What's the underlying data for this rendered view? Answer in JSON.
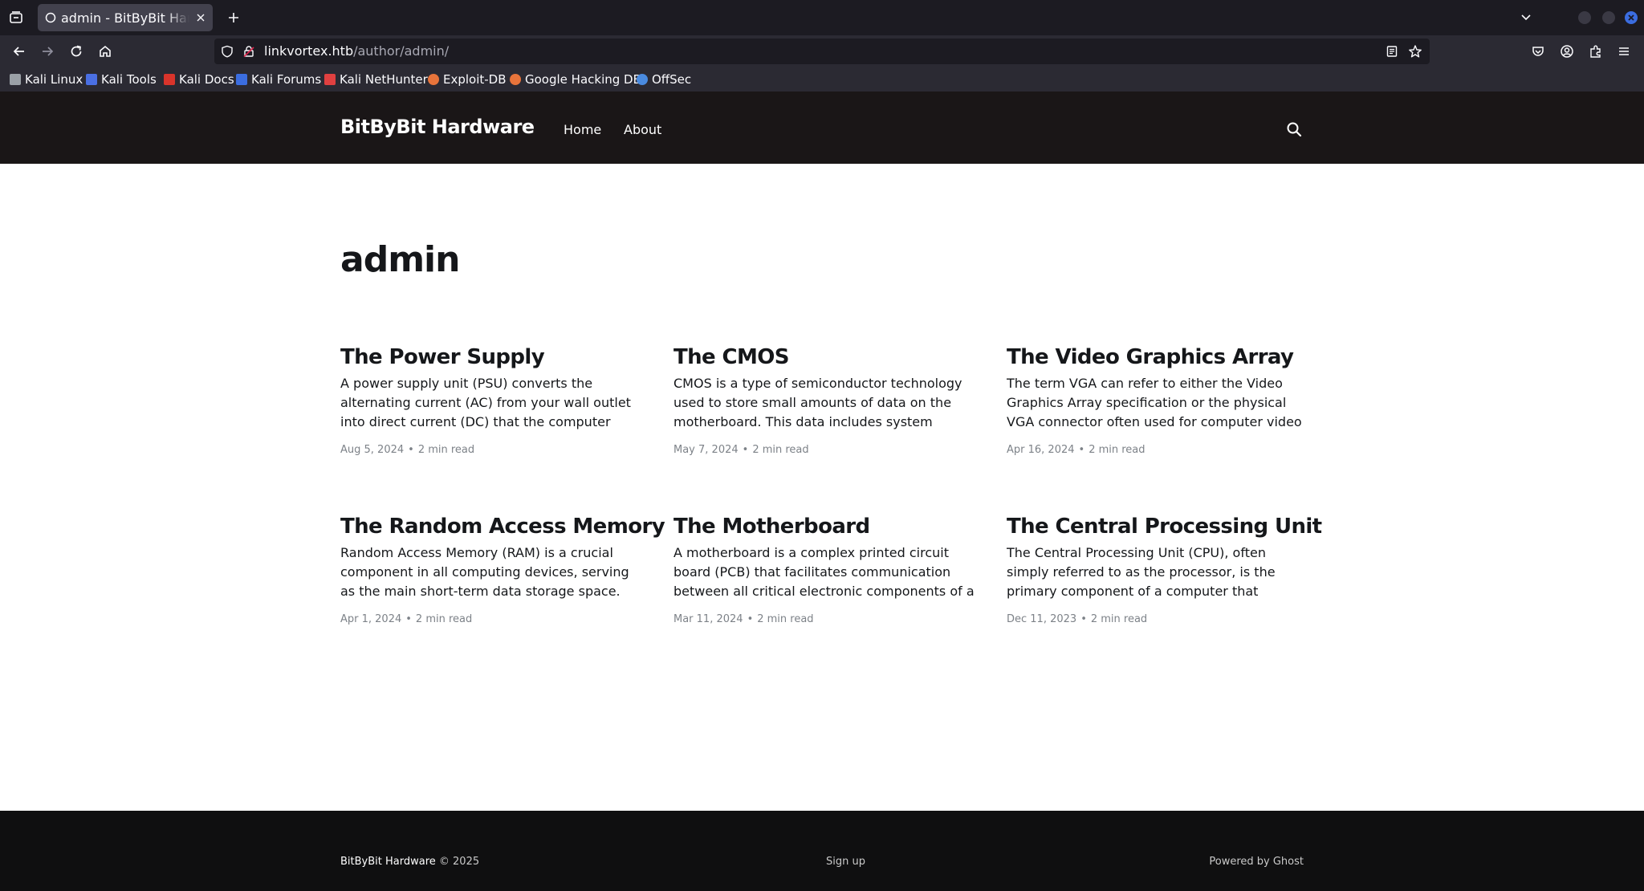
{
  "browser": {
    "tab": {
      "title": "admin - BitByBit Hardware"
    },
    "url": {
      "host": "linkvortex.htb",
      "path": "/author/admin/"
    },
    "bookmarks": [
      {
        "label": "Kali Linux",
        "icon": "kali-dragon-icon",
        "color": "#9aa0a6"
      },
      {
        "label": "Kali Tools",
        "icon": "kali-tools-icon",
        "color": "#4a6fe3"
      },
      {
        "label": "Kali Docs",
        "icon": "kali-docs-icon",
        "color": "#d9342b"
      },
      {
        "label": "Kali Forums",
        "icon": "kali-forums-icon",
        "color": "#3b6de0"
      },
      {
        "label": "Kali NetHunter",
        "icon": "nethunter-icon",
        "color": "#e04040"
      },
      {
        "label": "Exploit-DB",
        "icon": "exploitdb-icon",
        "color": "#e8743b"
      },
      {
        "label": "Google Hacking DB",
        "icon": "ghdb-icon",
        "color": "#e8743b"
      },
      {
        "label": "OffSec",
        "icon": "offsec-icon",
        "color": "#4a8be0"
      }
    ]
  },
  "site": {
    "brand": "BitByBit Hardware",
    "nav": [
      "Home",
      "About"
    ]
  },
  "author": {
    "name": "admin"
  },
  "posts": [
    {
      "title": "The Power Supply",
      "excerpt": "A power supply unit (PSU) converts the alternating current (AC) from your wall outlet into direct current (DC) that the computer components require. It…",
      "date": "Aug 5, 2024",
      "read": "2 min read"
    },
    {
      "title": "The CMOS",
      "excerpt": "CMOS is a type of semiconductor technology used to store small amounts of data on the motherboard. This data includes system settings and…",
      "date": "May 7, 2024",
      "read": "2 min read"
    },
    {
      "title": "The Video Graphics Array",
      "excerpt": "The term VGA can refer to either the Video Graphics Array specification or the physical VGA connector often used for computer video output. Below, I'll…",
      "date": "Apr 16, 2024",
      "read": "2 min read"
    },
    {
      "title": "The Random Access Memory",
      "excerpt": "Random Access Memory (RAM) is a crucial component in all computing devices, serving as the main short-term data storage space. RAM stores t…",
      "date": "Apr 1, 2024",
      "read": "2 min read"
    },
    {
      "title": "The Motherboard",
      "excerpt": "A motherboard is a complex printed circuit board (PCB) that facilitates communication between all critical electronic components of a computer,…",
      "date": "Mar 11, 2024",
      "read": "2 min read"
    },
    {
      "title": "The Central Processing Unit",
      "excerpt": "The Central Processing Unit (CPU), often simply referred to as the processor, is the primary component of a computer that performs most of…",
      "date": "Dec 11, 2023",
      "read": "2 min read"
    }
  ],
  "meta_separator": "•",
  "footer": {
    "brand": "BitByBit Hardware",
    "copyright": "© 2025",
    "signup": "Sign up",
    "powered": "Powered by Ghost"
  }
}
